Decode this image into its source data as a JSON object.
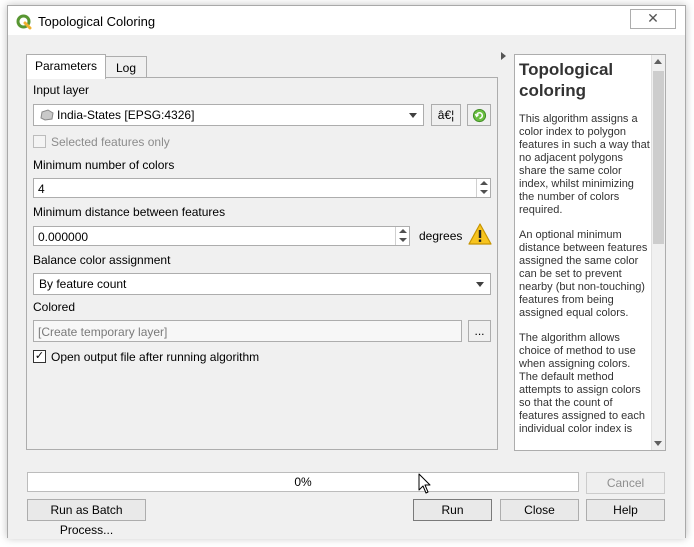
{
  "window": {
    "title": "Topological Coloring",
    "close_glyph": "✕"
  },
  "tabs": [
    {
      "label": "Parameters",
      "active": true
    },
    {
      "label": "Log",
      "active": false
    }
  ],
  "params": {
    "input_layer": {
      "label": "Input layer",
      "value": "India-States [EPSG:4326]",
      "options_button_label": "â€¦"
    },
    "selected_only": {
      "label": "Selected features only",
      "checked": false
    },
    "min_colors": {
      "label": "Minimum number of colors",
      "value": "4"
    },
    "min_distance": {
      "label": "Minimum distance between features",
      "value": "0.000000",
      "unit": "degrees"
    },
    "balance": {
      "label": "Balance color assignment",
      "value": "By feature count"
    },
    "colored": {
      "label": "Colored",
      "placeholder": "[Create temporary layer]",
      "browse_label": "..."
    },
    "open_output": {
      "label": "Open output file after running algorithm",
      "checked": true,
      "check_glyph": "✓"
    }
  },
  "help": {
    "title": "Topological coloring",
    "paragraphs": [
      "This algorithm assigns a color index to polygon features in such a way that no adjacent polygons share the same color index, whilst minimizing the number of colors required.",
      "An optional minimum distance between features assigned the same color can be set to prevent nearby (but non-touching) features from being assigned equal colors.",
      "The algorithm allows choice of method to use when assigning colors. The default method attempts to assign colors so that the count of features assigned to each individual color index is"
    ]
  },
  "progress": {
    "value": 0,
    "text": "0%"
  },
  "buttons": {
    "cancel": "Cancel",
    "batch": "Run as Batch Process...",
    "run": "Run",
    "close": "Close",
    "help": "Help"
  },
  "colors": {
    "qgis_green": "#589632",
    "warning_yellow": "#f7c41f"
  }
}
